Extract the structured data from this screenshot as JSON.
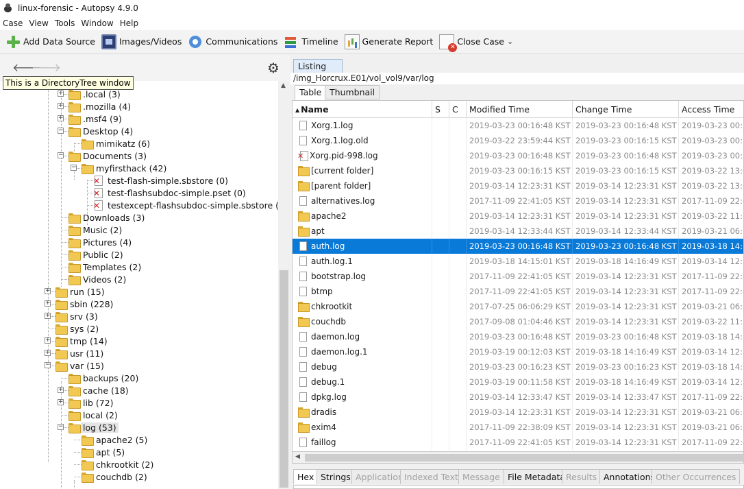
{
  "window": {
    "title": "linux-forensic - Autopsy 4.9.0"
  },
  "menu": [
    "Case",
    "View",
    "Tools",
    "Window",
    "Help"
  ],
  "toolbar": {
    "add_data_source": "Add Data Source",
    "images_videos": "Images/Videos",
    "communications": "Communications",
    "timeline": "Timeline",
    "generate_report": "Generate Report",
    "close_case": "Close Case"
  },
  "tooltip": "This is a DirectoryTree window",
  "tree": [
    {
      "label": ".gnupg (3)",
      "level": 2,
      "expander": "none",
      "partial": true
    },
    {
      "label": ".local (3)",
      "level": 2,
      "expander": "+"
    },
    {
      "label": ".mozilla (4)",
      "level": 2,
      "expander": "+"
    },
    {
      "label": ".msf4 (9)",
      "level": 2,
      "expander": "+"
    },
    {
      "label": "Desktop (4)",
      "level": 2,
      "expander": "-"
    },
    {
      "label": "mimikatz (6)",
      "level": 3,
      "expander": "none"
    },
    {
      "label": "Documents (3)",
      "level": 2,
      "expander": "-"
    },
    {
      "label": "myfirsthack (42)",
      "level": 3,
      "expander": "-"
    },
    {
      "label": "test-flash-simple.sbstore (0)",
      "level": 4,
      "type": "deleted"
    },
    {
      "label": "test-flashsubdoc-simple.pset (0)",
      "level": 4,
      "type": "deleted"
    },
    {
      "label": "testexcept-flashsubdoc-simple.sbstore (0)",
      "level": 4,
      "type": "deleted"
    },
    {
      "label": "Downloads (3)",
      "level": 2,
      "expander": "none"
    },
    {
      "label": "Music (2)",
      "level": 2,
      "expander": "none"
    },
    {
      "label": "Pictures (4)",
      "level": 2,
      "expander": "none"
    },
    {
      "label": "Public (2)",
      "level": 2,
      "expander": "none"
    },
    {
      "label": "Templates (2)",
      "level": 2,
      "expander": "none"
    },
    {
      "label": "Videos (2)",
      "level": 2,
      "expander": "none"
    },
    {
      "label": "run (15)",
      "level": 1,
      "expander": "+"
    },
    {
      "label": "sbin (228)",
      "level": 1,
      "expander": "+"
    },
    {
      "label": "srv (3)",
      "level": 1,
      "expander": "+"
    },
    {
      "label": "sys (2)",
      "level": 1,
      "expander": "none"
    },
    {
      "label": "tmp (14)",
      "level": 1,
      "expander": "+"
    },
    {
      "label": "usr (11)",
      "level": 1,
      "expander": "+"
    },
    {
      "label": "var (15)",
      "level": 1,
      "expander": "-"
    },
    {
      "label": "backups (20)",
      "level": 2,
      "expander": "none"
    },
    {
      "label": "cache (18)",
      "level": 2,
      "expander": "+"
    },
    {
      "label": "lib (72)",
      "level": 2,
      "expander": "+"
    },
    {
      "label": "local (2)",
      "level": 2,
      "expander": "none"
    },
    {
      "label": "log (53)",
      "level": 2,
      "expander": "-",
      "selected": true
    },
    {
      "label": "apache2 (5)",
      "level": 3,
      "expander": "none"
    },
    {
      "label": "apt (5)",
      "level": 3,
      "expander": "none"
    },
    {
      "label": "chkrootkit (2)",
      "level": 3,
      "expander": "none"
    },
    {
      "label": "couchdb (2)",
      "level": 3,
      "expander": "none"
    }
  ],
  "listing": {
    "tab_label": "Listing",
    "path": "/img_Horcrux.E01/vol_vol9/var/log",
    "view_tabs": [
      "Table",
      "Thumbnail"
    ],
    "columns": [
      "Name",
      "S",
      "C",
      "Modified Time",
      "Change Time",
      "Access Time"
    ],
    "rows": [
      {
        "icon": "file",
        "name": "Xorg.1.log",
        "modified": "2019-03-23 00:16:48 KST",
        "change": "2019-03-23 00:16:48 KST",
        "access": "2019-03-23 00:16"
      },
      {
        "icon": "file",
        "name": "Xorg.1.log.old",
        "modified": "2019-03-22 23:59:44 KST",
        "change": "2019-03-23 00:16:15 KST",
        "access": "2019-03-23 00:33"
      },
      {
        "icon": "deleted",
        "name": "Xorg.pid-998.log",
        "modified": "2019-03-23 00:16:48 KST",
        "change": "2019-03-23 00:16:48 KST",
        "access": "2019-03-23 00:16"
      },
      {
        "icon": "folder",
        "name": "[current folder]",
        "modified": "2019-03-23 00:16:15 KST",
        "change": "2019-03-23 00:16:15 KST",
        "access": "2019-03-22 13:06"
      },
      {
        "icon": "folder",
        "name": "[parent folder]",
        "modified": "2019-03-14 12:23:31 KST",
        "change": "2019-03-14 12:23:31 KST",
        "access": "2019-03-22 13:06"
      },
      {
        "icon": "file",
        "name": "alternatives.log",
        "modified": "2017-11-09 22:41:05 KST",
        "change": "2019-03-14 12:23:31 KST",
        "access": "2017-11-09 22:41"
      },
      {
        "icon": "folder",
        "name": "apache2",
        "modified": "2019-03-14 12:23:31 KST",
        "change": "2019-03-14 12:23:31 KST",
        "access": "2019-03-22 11:18"
      },
      {
        "icon": "folder",
        "name": "apt",
        "modified": "2019-03-14 12:33:44 KST",
        "change": "2019-03-14 12:33:44 KST",
        "access": "2019-03-21 06:32"
      },
      {
        "icon": "file",
        "name": "auth.log",
        "modified": "2019-03-23 00:16:48 KST",
        "change": "2019-03-23 00:16:48 KST",
        "access": "2019-03-18 14:16",
        "selected": true
      },
      {
        "icon": "file",
        "name": "auth.log.1",
        "modified": "2019-03-18 14:15:01 KST",
        "change": "2019-03-18 14:16:49 KST",
        "access": "2019-03-14 12:34"
      },
      {
        "icon": "file",
        "name": "bootstrap.log",
        "modified": "2017-11-09 22:41:05 KST",
        "change": "2019-03-14 12:23:31 KST",
        "access": "2017-11-09 22:41"
      },
      {
        "icon": "file",
        "name": "btmp",
        "modified": "2017-11-09 22:41:05 KST",
        "change": "2019-03-14 12:23:31 KST",
        "access": "2017-11-09 22:41"
      },
      {
        "icon": "folder",
        "name": "chkrootkit",
        "modified": "2017-07-25 06:06:29 KST",
        "change": "2019-03-14 12:23:31 KST",
        "access": "2019-03-21 06:32"
      },
      {
        "icon": "folder",
        "name": "couchdb",
        "modified": "2017-09-08 01:04:46 KST",
        "change": "2019-03-14 12:23:31 KST",
        "access": "2019-03-22 11:18"
      },
      {
        "icon": "file",
        "name": "daemon.log",
        "modified": "2019-03-23 00:16:48 KST",
        "change": "2019-03-23 00:16:48 KST",
        "access": "2019-03-18 14:16"
      },
      {
        "icon": "file",
        "name": "daemon.log.1",
        "modified": "2019-03-19 00:12:03 KST",
        "change": "2019-03-18 14:16:49 KST",
        "access": "2019-03-14 12:34"
      },
      {
        "icon": "file",
        "name": "debug",
        "modified": "2019-03-23 00:16:23 KST",
        "change": "2019-03-23 00:16:23 KST",
        "access": "2019-03-18 14:16"
      },
      {
        "icon": "file",
        "name": "debug.1",
        "modified": "2019-03-19 00:11:58 KST",
        "change": "2019-03-18 14:16:49 KST",
        "access": "2019-03-14 12:34"
      },
      {
        "icon": "file",
        "name": "dpkg.log",
        "modified": "2019-03-14 12:33:47 KST",
        "change": "2019-03-14 12:33:47 KST",
        "access": "2017-11-09 22:41"
      },
      {
        "icon": "folder",
        "name": "dradis",
        "modified": "2019-03-14 12:23:31 KST",
        "change": "2019-03-14 12:23:31 KST",
        "access": "2019-03-21 06:32"
      },
      {
        "icon": "folder",
        "name": "exim4",
        "modified": "2017-11-09 22:38:09 KST",
        "change": "2019-03-14 12:23:31 KST",
        "access": "2019-03-21 06:32"
      },
      {
        "icon": "file",
        "name": "faillog",
        "modified": "2017-11-09 22:41:05 KST",
        "change": "2019-03-14 12:23:31 KST",
        "access": "2017-11-09 22:41"
      }
    ]
  },
  "bottom_tabs": [
    {
      "label": "Hex",
      "state": "active"
    },
    {
      "label": "Strings",
      "state": "normal"
    },
    {
      "label": "Application",
      "state": "disabled"
    },
    {
      "label": "Indexed Text",
      "state": "disabled"
    },
    {
      "label": "Message",
      "state": "disabled"
    },
    {
      "label": "File Metadata",
      "state": "normal"
    },
    {
      "label": "Results",
      "state": "disabled"
    },
    {
      "label": "Annotations",
      "state": "normal"
    },
    {
      "label": "Other Occurrences",
      "state": "disabled"
    }
  ]
}
